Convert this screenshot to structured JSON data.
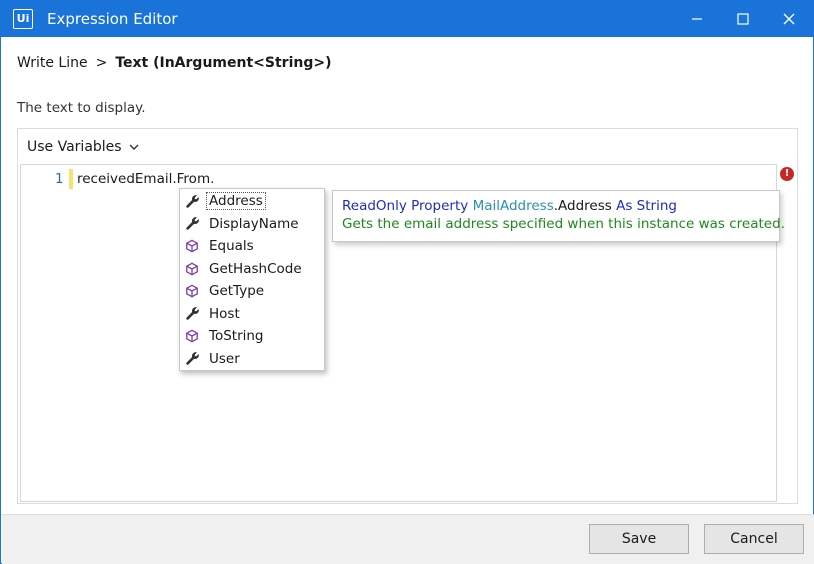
{
  "window": {
    "title": "Expression Editor",
    "logo_text": "Ui",
    "accent_color": "#1a73d9",
    "controls": [
      "minimize-icon",
      "maximize-icon",
      "close-icon"
    ]
  },
  "breadcrumb": {
    "parent": "Write Line",
    "separator": ">",
    "current": "Text (InArgument<String>)"
  },
  "description": "The text to display.",
  "editor": {
    "use_variables_label": "Use Variables",
    "lines": [
      {
        "number": "1",
        "text": "receivedEmail.From."
      }
    ],
    "error_indicator": "!"
  },
  "completion": {
    "items": [
      {
        "label": "Address",
        "icon": "wrench-icon",
        "selected": true
      },
      {
        "label": "DisplayName",
        "icon": "wrench-icon",
        "selected": false
      },
      {
        "label": "Equals",
        "icon": "cube-icon",
        "selected": false
      },
      {
        "label": "GetHashCode",
        "icon": "cube-icon",
        "selected": false
      },
      {
        "label": "GetType",
        "icon": "cube-icon",
        "selected": false
      },
      {
        "label": "Host",
        "icon": "wrench-icon",
        "selected": false
      },
      {
        "label": "ToString",
        "icon": "cube-icon",
        "selected": false
      },
      {
        "label": "User",
        "icon": "wrench-icon",
        "selected": false
      }
    ]
  },
  "tooltip": {
    "kw_readonly_property": "ReadOnly Property",
    "type_name": "MailAddress",
    "member": ".Address",
    "kw_as_string": "As String",
    "doc": "Gets the email address specified when this instance was created."
  },
  "footer": {
    "save_label": "Save",
    "cancel_label": "Cancel"
  }
}
